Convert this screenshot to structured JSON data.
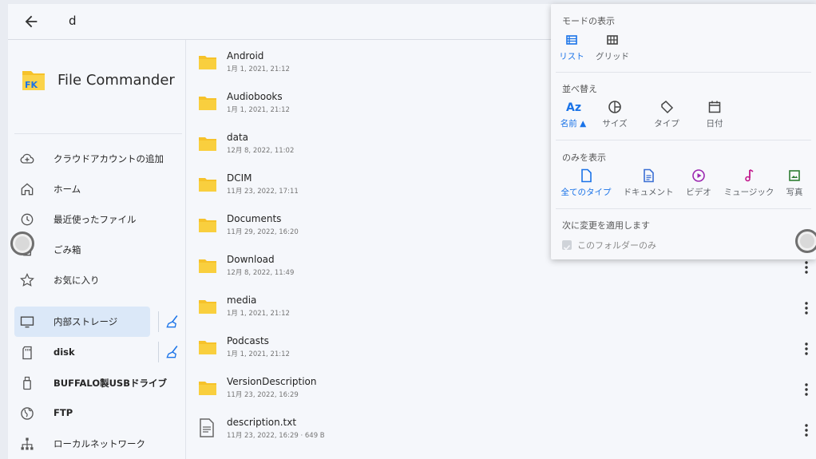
{
  "topbar": {
    "search_text": "d",
    "back_icon": "arrow-back-icon"
  },
  "sidebar": {
    "app_name": "File Commander",
    "items": [
      {
        "label": "クラウドアカウントの追加",
        "icon": "cloud-add-icon"
      },
      {
        "label": "ホーム",
        "icon": "home-icon"
      },
      {
        "label": "最近使ったファイル",
        "icon": "clock-icon"
      },
      {
        "label": "ごみ箱",
        "icon": "trash-icon"
      },
      {
        "label": "お気に入り",
        "icon": "star-icon"
      },
      {
        "label": "内部ストレージ",
        "icon": "monitor-icon"
      },
      {
        "label": "disk",
        "icon": "sd-card-icon"
      },
      {
        "label": "BUFFALO製USBドライブ",
        "icon": "usb-icon"
      },
      {
        "label": "FTP",
        "icon": "globe-icon"
      },
      {
        "label": "ローカルネットワーク",
        "icon": "network-icon"
      }
    ]
  },
  "files": [
    {
      "name": "Android",
      "meta": "1月 1, 2021, 21:12",
      "type": "folder"
    },
    {
      "name": "Audiobooks",
      "meta": "1月 1, 2021, 21:12",
      "type": "folder"
    },
    {
      "name": "data",
      "meta": "12月 8, 2022, 11:02",
      "type": "folder"
    },
    {
      "name": "DCIM",
      "meta": "11月 23, 2022, 17:11",
      "type": "folder"
    },
    {
      "name": "Documents",
      "meta": "11月 29, 2022, 16:20",
      "type": "folder"
    },
    {
      "name": "Download",
      "meta": "12月 8, 2022, 11:49",
      "type": "folder"
    },
    {
      "name": "media",
      "meta": "1月 1, 2021, 21:12",
      "type": "folder"
    },
    {
      "name": "Podcasts",
      "meta": "1月 1, 2021, 21:12",
      "type": "folder"
    },
    {
      "name": "VersionDescription",
      "meta": "11月 23, 2022, 16:29",
      "type": "folder"
    },
    {
      "name": "description.txt",
      "meta": "11月 23, 2022, 16:29 · 649 B",
      "type": "file"
    }
  ],
  "menu": {
    "view_mode": {
      "title": "モードの表示",
      "options": [
        {
          "label": "リスト",
          "icon": "list-view-icon",
          "selected": true
        },
        {
          "label": "グリッド",
          "icon": "grid-view-icon",
          "selected": false
        }
      ]
    },
    "sort": {
      "title": "並べ替え",
      "options": [
        {
          "label": "名前 ▲",
          "icon": "sort-name-icon",
          "selected": true
        },
        {
          "label": "サイズ",
          "icon": "pie-size-icon",
          "selected": false
        },
        {
          "label": "タイプ",
          "icon": "tag-icon",
          "selected": false
        },
        {
          "label": "日付",
          "icon": "calendar-icon",
          "selected": false
        }
      ]
    },
    "filter": {
      "title": "のみを表示",
      "options": [
        {
          "label": "全てのタイプ",
          "icon": "file-icon",
          "selected": true
        },
        {
          "label": "ドキュメント",
          "icon": "document-icon",
          "selected": false
        },
        {
          "label": "ビデオ",
          "icon": "video-icon",
          "selected": false
        },
        {
          "label": "ミュージック",
          "icon": "music-icon",
          "selected": false
        },
        {
          "label": "写真",
          "icon": "photo-icon",
          "selected": false
        }
      ]
    },
    "apply": {
      "title": "次に変更を適用します",
      "checkbox_label": "このフォルダーのみ",
      "checked": true
    }
  },
  "colors": {
    "accent": "#1a73e8",
    "folder": "#f6c22a",
    "document": "#3b6fd4",
    "video": "#9c27b0",
    "music": "#c2188c",
    "photo": "#2e7d32"
  }
}
